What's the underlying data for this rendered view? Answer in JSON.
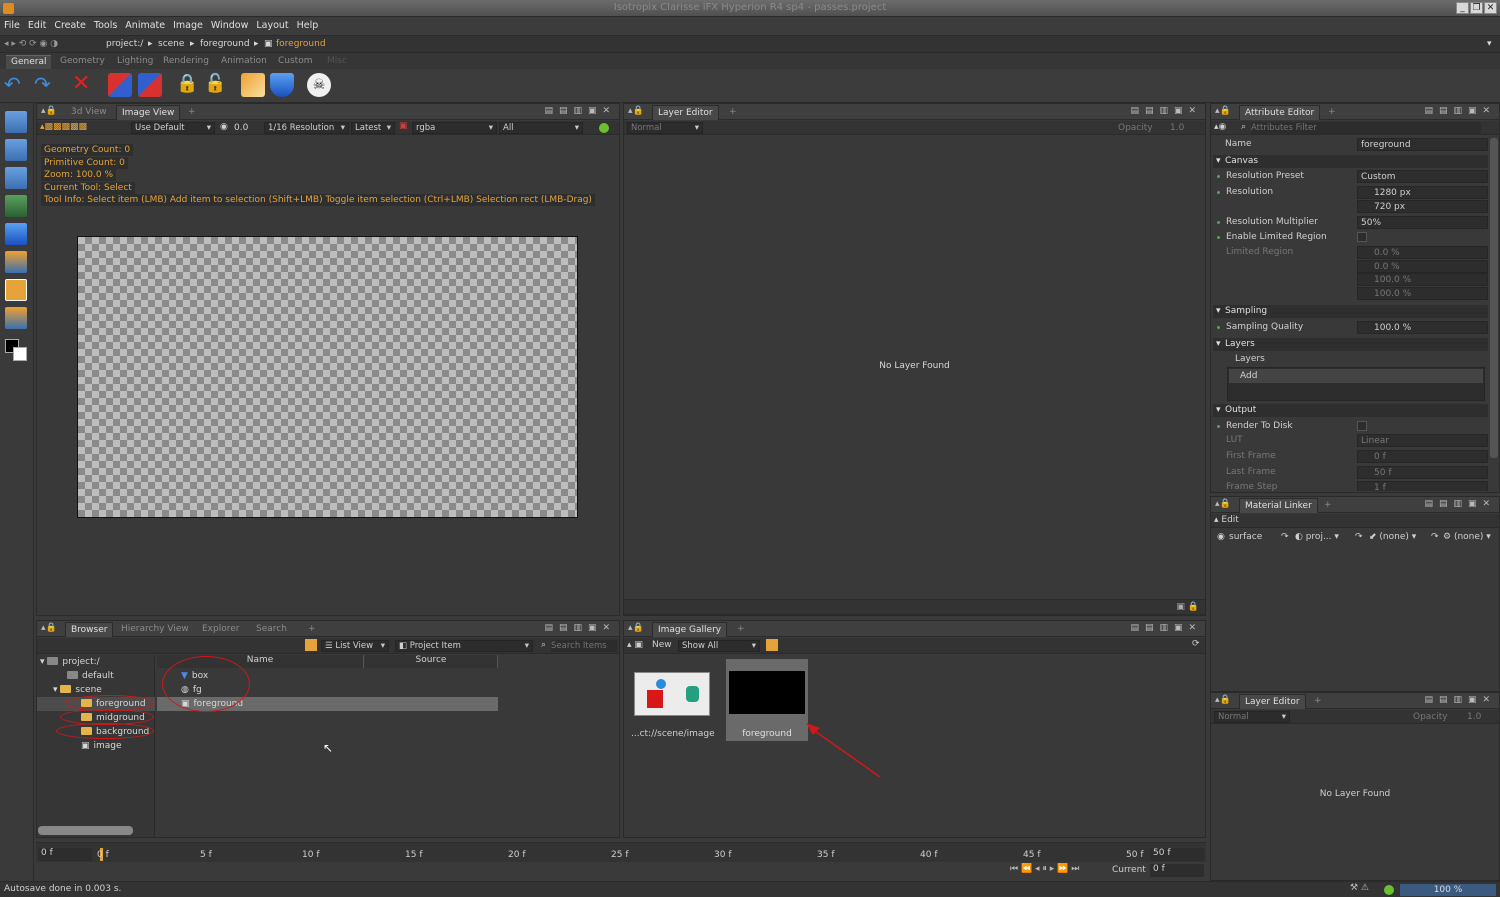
{
  "window": {
    "title": "Isotropix Clarisse iFX Hyperion R4 sp4 - passes.project"
  },
  "menu": [
    "File",
    "Edit",
    "Create",
    "Tools",
    "Animate",
    "Image",
    "Window",
    "Layout",
    "Help"
  ],
  "breadcrumb": [
    "project:/",
    "scene",
    "foreground",
    "foreground"
  ],
  "shelf_tabs": [
    "General",
    "Geometry",
    "Lighting",
    "Rendering",
    "Animation",
    "Custom",
    "Misc"
  ],
  "viewer": {
    "tabs": [
      "3d View",
      "Image View"
    ],
    "use_default": "Use Default",
    "exposure": "0.0",
    "resolution": "1/16 Resolution",
    "latest": "Latest",
    "channel": "rgba",
    "all": "All",
    "info": [
      "Geometry Count: 0",
      "Primitive Count: 0",
      "Zoom: 100.0 %",
      "Current Tool: Select",
      "Tool Info: Select item (LMB)  Add item to selection (Shift+LMB)  Toggle item selection (Ctrl+LMB)  Selection rect (LMB-Drag)"
    ]
  },
  "layer_editor": {
    "tab": "Layer Editor",
    "mode": "Normal",
    "opacity_label": "Opacity",
    "opacity": "1.0",
    "empty": "No Layer Found"
  },
  "attribute_editor": {
    "tab": "Attribute Editor",
    "filter_placeholder": "Attributes Filter",
    "name_label": "Name",
    "name_value": "foreground",
    "sections": {
      "canvas": "Canvas",
      "sampling": "Sampling",
      "layers": "Layers",
      "output": "Output"
    },
    "rows": {
      "resolution_preset": "Resolution Preset",
      "resolution_preset_value": "Custom",
      "resolution": "Resolution",
      "res_w": "1280 px",
      "res_h": "720 px",
      "resolution_multiplier": "Resolution Multiplier",
      "resolution_multiplier_value": "50%",
      "enable_limited_region": "Enable Limited Region",
      "limited_region": "Limited Region",
      "lr": [
        "0.0 %",
        "0.0 %",
        "100.0 %",
        "100.0 %"
      ],
      "sampling_quality": "Sampling Quality",
      "sampling_quality_value": "100.0 %",
      "layers_sub": "Layers",
      "add": "Add",
      "render_to_disk": "Render To Disk",
      "lut": "LUT",
      "lut_value": "Linear",
      "first_frame": "First Frame",
      "first_frame_value": "0 f",
      "last_frame": "Last Frame",
      "last_frame_value": "50 f",
      "frame_step": "Frame Step",
      "frame_step_value": "1 f"
    }
  },
  "material_linker": {
    "tab": "Material Linker",
    "edit": "Edit",
    "surface": "surface",
    "proj": "proj...",
    "none1": "(none)",
    "none2": "(none)"
  },
  "layer_editor2": {
    "tab": "Layer Editor",
    "mode": "Normal",
    "opacity_label": "Opacity",
    "opacity": "1.0",
    "empty": "No Layer Found"
  },
  "browser": {
    "tabs": [
      "Browser",
      "Hierarchy View",
      "Explorer",
      "Search"
    ],
    "view": "List View",
    "item_type": "Project Item",
    "search_placeholder": "Search Items",
    "tree": [
      "project:/",
      "default",
      "scene",
      "foreground",
      "midground",
      "background",
      "image"
    ],
    "columns": [
      "Name",
      "Source"
    ],
    "items": [
      "box",
      "fg",
      "foreground"
    ]
  },
  "gallery": {
    "tab": "Image Gallery",
    "new": "New",
    "show": "Show All",
    "thumbs": [
      "...ct://scene/image",
      "foreground"
    ]
  },
  "timeline": {
    "start": "0 f",
    "end": "50 f",
    "ticks": [
      "0 f",
      "5 f",
      "10 f",
      "15 f",
      "20 f",
      "25 f",
      "30 f",
      "35 f",
      "40 f",
      "45 f",
      "50 f"
    ],
    "current_label": "Current",
    "current": "0 f"
  },
  "status": {
    "text": "Autosave done in 0.003 s.",
    "zoom": "100 %"
  }
}
